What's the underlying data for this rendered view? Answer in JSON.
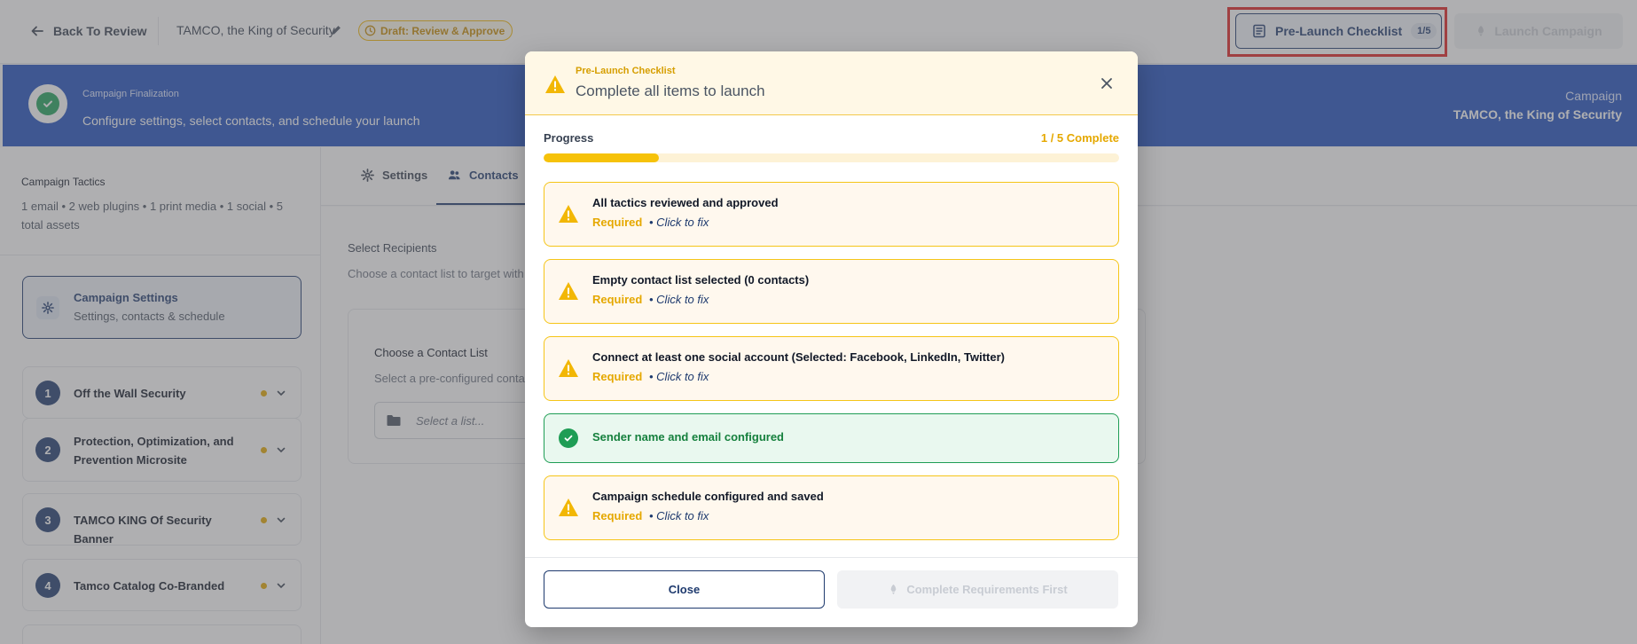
{
  "topbar": {
    "back_label": "Back To Review",
    "campaign_name": "TAMCO, the King of Security",
    "draft_badge": "Draft: Review & Approve",
    "checklist_label": "Pre-Launch Checklist",
    "checklist_count": "1/5",
    "launch_label": "Launch Campaign"
  },
  "banner": {
    "kicker": "Campaign Finalization",
    "subtitle": "Configure settings, select contacts, and schedule your launch",
    "right_label": "Campaign",
    "right_value": "TAMCO, the King of Security"
  },
  "sidebar": {
    "tactics_title": "Campaign Tactics",
    "tactics_desc": "1 email • 2 web plugins • 1 print media • 1 social • 5 total assets",
    "settings_card": {
      "title": "Campaign Settings",
      "subtitle": "Settings, contacts & schedule"
    },
    "tactics": [
      {
        "num": "1",
        "label": "Off the Wall Security"
      },
      {
        "num": "2",
        "label": "Protection, Optimization, and Prevention Microsite"
      },
      {
        "num": "3",
        "label": "TAMCO KING Of Security Banner"
      },
      {
        "num": "4",
        "label": "Tamco Catalog Co-Branded"
      }
    ]
  },
  "main": {
    "tabs": [
      {
        "label": "Settings"
      },
      {
        "label": "Contacts"
      }
    ],
    "select_recipients": "Select Recipients",
    "choose_desc": "Choose a contact list to target with t",
    "contact_card_title": "Choose a Contact List",
    "contact_card_desc": "Select a pre-configured contac",
    "select_placeholder": "Select a list..."
  },
  "modal": {
    "kicker": "Pre-Launch Checklist",
    "title": "Complete all items to launch",
    "progress_label": "Progress",
    "progress_count": "1 / 5 Complete",
    "progress_fraction": 0.2,
    "items": [
      {
        "title": "All tactics reviewed and approved",
        "required": "Required",
        "fix": "• Click to fix",
        "status": "warning"
      },
      {
        "title": "Empty contact list selected (0 contacts)",
        "required": "Required",
        "fix": "• Click to fix",
        "status": "warning"
      },
      {
        "title": "Connect at least one social account (Selected: Facebook, LinkedIn, Twitter)",
        "required": "Required",
        "fix": "• Click to fix",
        "status": "warning"
      },
      {
        "title": "Sender name and email configured",
        "status": "complete"
      },
      {
        "title": "Campaign schedule configured and saved",
        "required": "Required",
        "fix": "• Click to fix",
        "status": "warning"
      }
    ],
    "close_label": "Close",
    "complete_label": "Complete Requirements First"
  },
  "colors": {
    "navy": "#1e3a6e",
    "banner_blue": "#1e4fbf",
    "warning": "#e5a800",
    "success": "#1f9d55",
    "highlight": "#e02020"
  }
}
